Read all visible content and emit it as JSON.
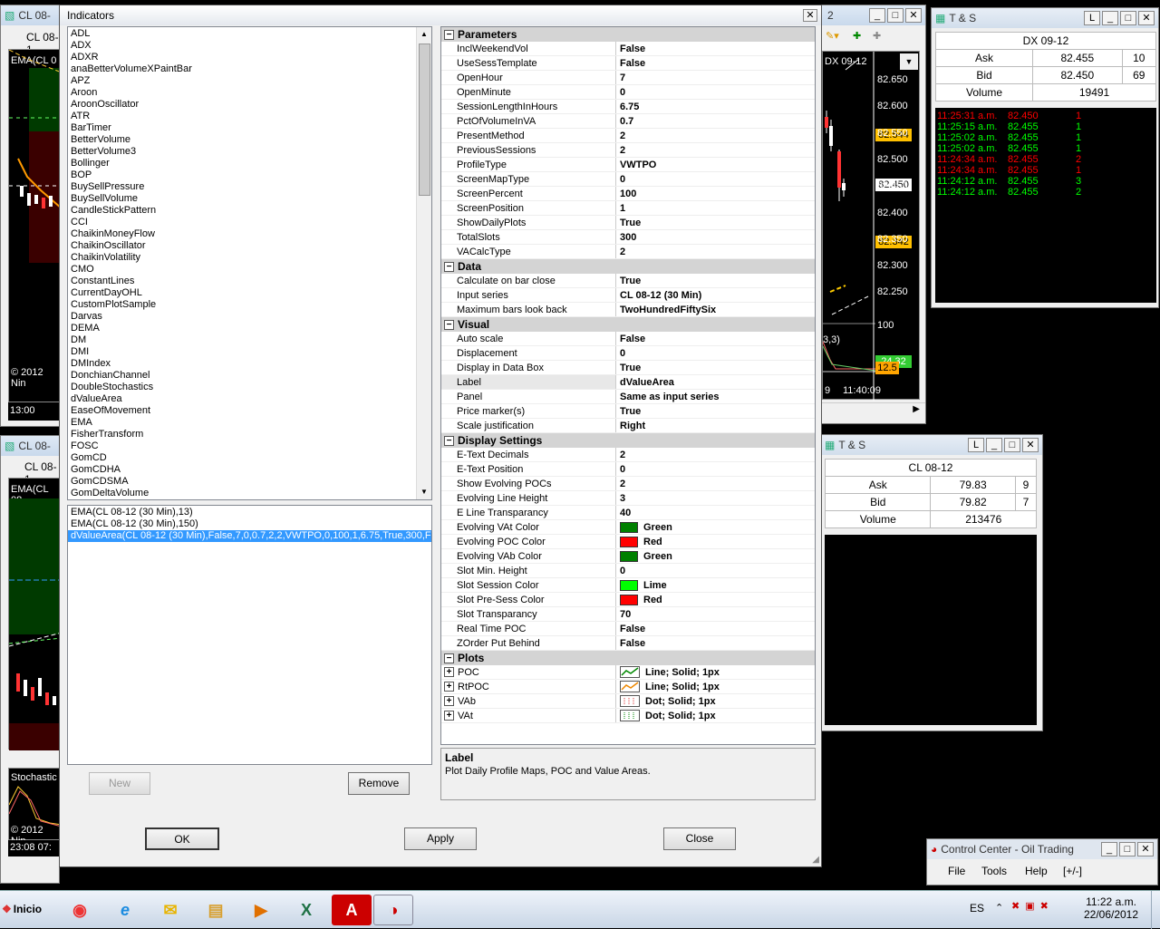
{
  "left_charts": {
    "top": {
      "title": "CL 08-",
      "instrument": "CL 08-1",
      "ema_label": "EMA(CL 0",
      "copyright": "© 2012 Nin",
      "time": "13:00"
    },
    "bottom": {
      "title": "CL 08-",
      "instrument": "CL 08-1",
      "ema_label": "EMA(CL 08",
      "stoch_label": "Stochastic",
      "copyright": "© 2012 Nin",
      "time1": "23:08",
      "time2": "07:"
    }
  },
  "right_chart": {
    "title_num": "2",
    "instrument": "DX 09-12",
    "y_ticks": [
      "82.650",
      "82.600",
      "82.550",
      "82.500",
      "82.450",
      "82.400",
      "82.350",
      "82.300",
      "82.250"
    ],
    "tag_a": "82.544",
    "tag_b": "82.450",
    "tag_c": "82.342",
    "ind_tick": "100",
    "ind_tag_a": "24.32",
    "ind_tag_b": "12.5",
    "ind_label": "3,3)",
    "time_a": "9",
    "time_b": "11:40:09"
  },
  "ts1": {
    "title": "T & S",
    "instrument": "DX 09-12",
    "ask_label": "Ask",
    "ask_price": "82.455",
    "ask_size": "10",
    "bid_label": "Bid",
    "bid_price": "82.450",
    "bid_size": "69",
    "volume_label": "Volume",
    "volume": "19491",
    "trades": [
      {
        "time": "11:25:31 a.m.",
        "price": "82.450",
        "size": "1",
        "color": "#ff0000"
      },
      {
        "time": "11:25:15 a.m.",
        "price": "82.455",
        "size": "1",
        "color": "#00ff00"
      },
      {
        "time": "11:25:02 a.m.",
        "price": "82.455",
        "size": "1",
        "color": "#00ff00"
      },
      {
        "time": "11:25:02 a.m.",
        "price": "82.455",
        "size": "1",
        "color": "#00ff00"
      },
      {
        "time": "11:24:34 a.m.",
        "price": "82.455",
        "size": "2",
        "color": "#ff0000"
      },
      {
        "time": "11:24:34 a.m.",
        "price": "82.455",
        "size": "1",
        "color": "#ff0000"
      },
      {
        "time": "11:24:12 a.m.",
        "price": "82.455",
        "size": "3",
        "color": "#00ff00"
      },
      {
        "time": "11:24:12 a.m.",
        "price": "82.455",
        "size": "2",
        "color": "#00ff00"
      }
    ]
  },
  "ts2": {
    "title": "T & S",
    "instrument": "CL 08-12",
    "ask_label": "Ask",
    "ask_price": "79.83",
    "ask_size": "9",
    "bid_label": "Bid",
    "bid_price": "79.82",
    "bid_size": "7",
    "volume_label": "Volume",
    "volume": "213476"
  },
  "control_center": {
    "title": "Control Center - Oil Trading",
    "menu": [
      "File",
      "Tools",
      "Help",
      "[+/-]"
    ]
  },
  "dialog": {
    "title": "Indicators",
    "close": "✕",
    "available": [
      "ADL",
      "ADX",
      "ADXR",
      "anaBetterVolumeXPaintBar",
      "APZ",
      "Aroon",
      "AroonOscillator",
      "ATR",
      "BarTimer",
      "BetterVolume",
      "BetterVolume3",
      "Bollinger",
      "BOP",
      "BuySellPressure",
      "BuySellVolume",
      "CandleStickPattern",
      "CCI",
      "ChaikinMoneyFlow",
      "ChaikinOscillator",
      "ChaikinVolatility",
      "CMO",
      "ConstantLines",
      "CurrentDayOHL",
      "CustomPlotSample",
      "Darvas",
      "DEMA",
      "DM",
      "DMI",
      "DMIndex",
      "DonchianChannel",
      "DoubleStochastics",
      "dValueArea",
      "EaseOfMovement",
      "EMA",
      "FisherTransform",
      "FOSC",
      "GomCD",
      "GomCDHA",
      "GomCDSMA",
      "GomDeltaVolume"
    ],
    "applied": [
      "EMA(CL 08-12 (30 Min),13)",
      "EMA(CL 08-12 (30 Min),150)",
      "dValueArea(CL 08-12 (30 Min),False,7,0,0.7,2,2,VWTPO,0,100,1,6.75,True,300,Fals"
    ],
    "new_btn": "New",
    "remove_btn": "Remove",
    "ok_btn": "OK",
    "apply_btn": "Apply",
    "close_btn": "Close",
    "desc_title": "Label",
    "desc_text": "Plot Daily Profile Maps, POC and Value Areas.",
    "categories": [
      {
        "name": "Parameters",
        "rows": [
          {
            "k": "InclWeekendVol",
            "v": "False"
          },
          {
            "k": "UseSessTemplate",
            "v": "False"
          },
          {
            "k": "OpenHour",
            "v": "7"
          },
          {
            "k": "OpenMinute",
            "v": "0"
          },
          {
            "k": "SessionLengthInHours",
            "v": "6.75"
          },
          {
            "k": "PctOfVolumeInVA",
            "v": "0.7"
          },
          {
            "k": "PresentMethod",
            "v": "2"
          },
          {
            "k": "PreviousSessions",
            "v": "2"
          },
          {
            "k": "ProfileType",
            "v": "VWTPO"
          },
          {
            "k": "ScreenMapType",
            "v": "0"
          },
          {
            "k": "ScreenPercent",
            "v": "100"
          },
          {
            "k": "ScreenPosition",
            "v": "1"
          },
          {
            "k": "ShowDailyPlots",
            "v": "True"
          },
          {
            "k": "TotalSlots",
            "v": "300"
          },
          {
            "k": "VACalcType",
            "v": "2"
          }
        ]
      },
      {
        "name": "Data",
        "rows": [
          {
            "k": "Calculate on bar close",
            "v": "True"
          },
          {
            "k": "Input series",
            "v": "CL 08-12 (30 Min)"
          },
          {
            "k": "Maximum bars look back",
            "v": "TwoHundredFiftySix"
          }
        ]
      },
      {
        "name": "Visual",
        "rows": [
          {
            "k": "Auto scale",
            "v": "False"
          },
          {
            "k": "Displacement",
            "v": "0"
          },
          {
            "k": "Display in Data Box",
            "v": "True"
          },
          {
            "k": "Label",
            "v": "dValueArea",
            "selected": true
          },
          {
            "k": "Panel",
            "v": "Same as input series"
          },
          {
            "k": "Price marker(s)",
            "v": "True"
          },
          {
            "k": "Scale justification",
            "v": "Right"
          }
        ]
      },
      {
        "name": "Display Settings",
        "rows": [
          {
            "k": "E-Text Decimals",
            "v": "2"
          },
          {
            "k": "E-Text Position",
            "v": "0"
          },
          {
            "k": "Show Evolving POCs",
            "v": "2"
          },
          {
            "k": "Evolving Line Height",
            "v": "3"
          },
          {
            "k": "E Line Transparancy",
            "v": "40"
          },
          {
            "k": "Evolving VAt Color",
            "v": "Green",
            "color": "#008000"
          },
          {
            "k": "Evolving POC Color",
            "v": "Red",
            "color": "#ff0000"
          },
          {
            "k": "Evolving VAb Color",
            "v": "Green",
            "color": "#008000"
          },
          {
            "k": "Slot Min. Height",
            "v": "0"
          },
          {
            "k": "Slot Session Color",
            "v": "Lime",
            "color": "#00ff00"
          },
          {
            "k": "Slot Pre-Sess Color",
            "v": "Red",
            "color": "#ff0000"
          },
          {
            "k": "Slot Transparancy",
            "v": "70"
          },
          {
            "k": "Real Time POC",
            "v": "False"
          },
          {
            "k": "ZOrder Put Behind",
            "v": "False"
          }
        ]
      },
      {
        "name": "Plots",
        "rows": [
          {
            "k": "POC",
            "v": "Line; Solid; 1px",
            "plot": "line-green",
            "expand": true
          },
          {
            "k": "RtPOC",
            "v": "Line; Solid; 1px",
            "plot": "line-orange",
            "expand": true
          },
          {
            "k": "VAb",
            "v": "Dot; Solid; 1px",
            "plot": "dot-red",
            "expand": true
          },
          {
            "k": "VAt",
            "v": "Dot; Solid; 1px",
            "plot": "dot-green",
            "expand": true
          }
        ]
      }
    ]
  },
  "taskbar": {
    "start": "Inicio",
    "lang": "ES",
    "time": "11:22 a.m.",
    "date": "22/06/2012"
  }
}
